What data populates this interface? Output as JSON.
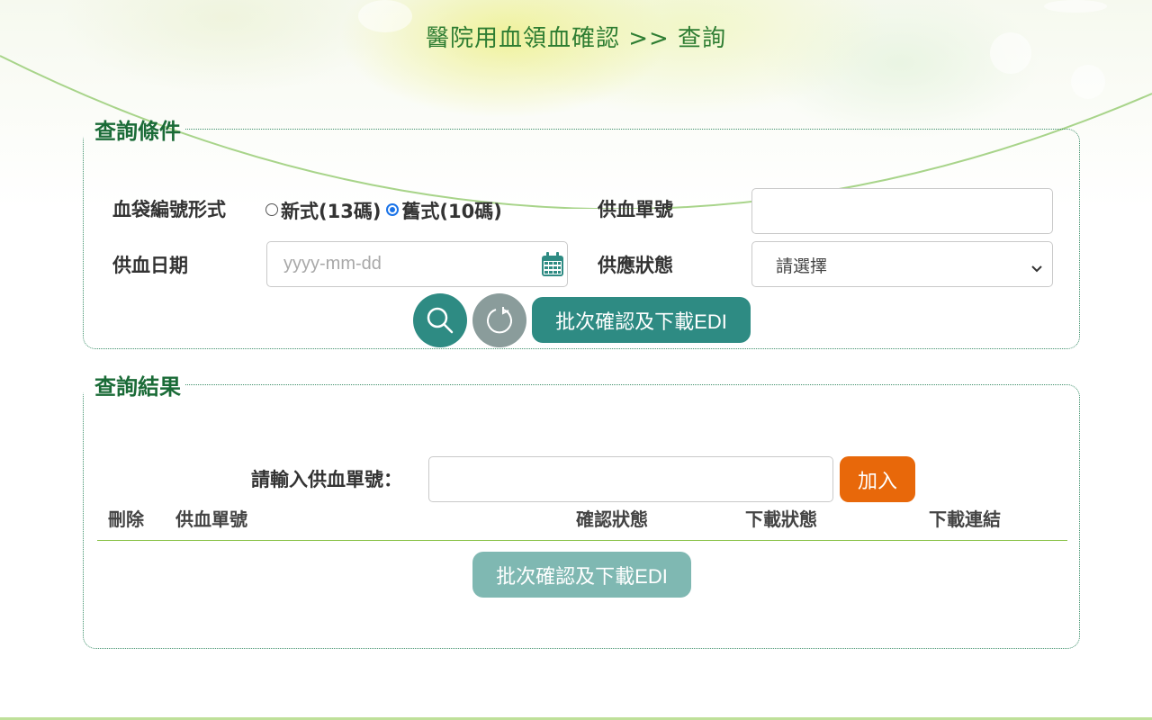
{
  "header": {
    "title": "醫院用血領血確認 >> 查詢"
  },
  "search": {
    "legend": "查詢條件",
    "bag_format_label": "血袋編號形式",
    "bag_format_options": [
      {
        "label": "新式(13碼)",
        "checked": false
      },
      {
        "label": "舊式(10碼)",
        "checked": true
      }
    ],
    "supply_no_label": "供血單號",
    "supply_no_value": "",
    "supply_date_label": "供血日期",
    "supply_date_placeholder": "yyyy-mm-dd",
    "status_label": "供應狀態",
    "status_selected": "請選擇",
    "batch_button": "批次確認及下載EDI"
  },
  "result": {
    "legend": "查詢結果",
    "input_label": "請輸入供血單號：",
    "input_value": "",
    "add_button": "加入",
    "columns": [
      "刪除",
      "供血單號",
      "確認狀態",
      "下載狀態",
      "下載連結"
    ],
    "rows": [],
    "batch_button": "批次確認及下載EDI"
  },
  "icons": {
    "search": "search-icon",
    "reset": "refresh-icon",
    "calendar": "calendar-icon",
    "dropdown": "chevron-down-icon"
  },
  "colors": {
    "accent_teal": "#2e8b83",
    "title_green": "#2e7d32",
    "add_orange": "#e8680a"
  }
}
